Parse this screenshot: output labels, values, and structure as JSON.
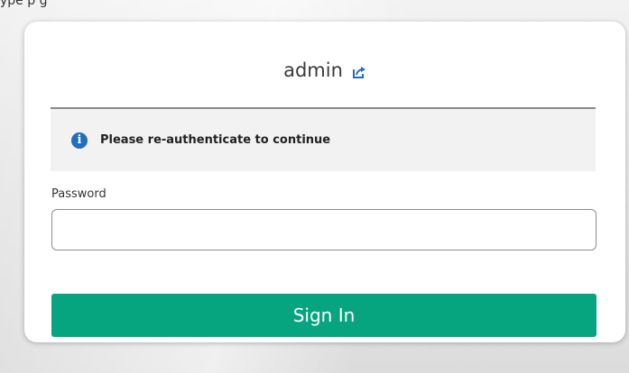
{
  "background": {
    "top_text": "ype                                                           p                   g"
  },
  "user": {
    "name": "admin",
    "switch_icon": "external-link-icon"
  },
  "notice": {
    "icon": "info-icon",
    "text": "Please re-authenticate to continue"
  },
  "form": {
    "password_label": "Password",
    "password_value": "",
    "password_placeholder": ""
  },
  "actions": {
    "sign_in_label": "Sign In"
  },
  "colors": {
    "primary_button": "#06a57f",
    "info_icon": "#1f6fbd",
    "notice_background": "#f2f2f2"
  }
}
